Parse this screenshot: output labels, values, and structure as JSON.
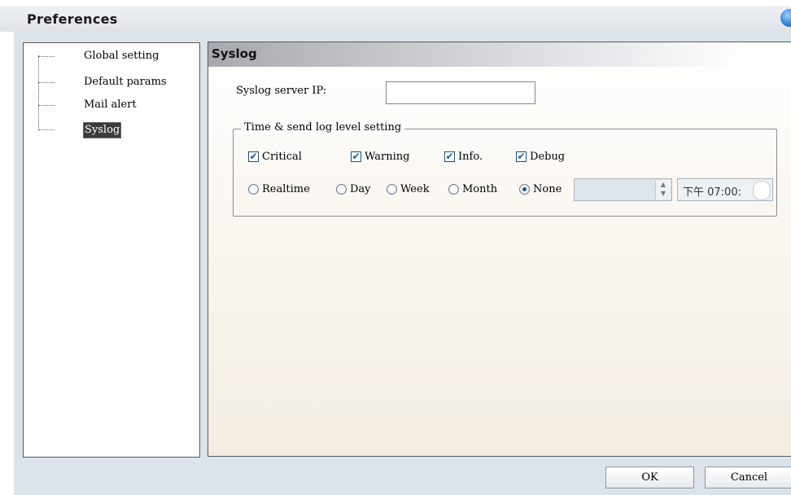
{
  "window": {
    "title": "Preferences"
  },
  "tree": {
    "items": [
      {
        "label": "Global setting"
      },
      {
        "label": "Default params"
      },
      {
        "label": "Mail alert"
      },
      {
        "label": "Syslog",
        "selected": true
      }
    ]
  },
  "section": {
    "title": "Syslog"
  },
  "syslog": {
    "server_ip_label": "Syslog server IP:",
    "server_ip_value": ""
  },
  "log_group": {
    "legend": "Time & send log level setting",
    "levels": [
      {
        "label": "Critical",
        "checked": true
      },
      {
        "label": "Warning",
        "checked": true
      },
      {
        "label": "Info.",
        "checked": true
      },
      {
        "label": "Debug",
        "checked": true
      }
    ],
    "schedule": [
      {
        "label": "Realtime",
        "selected": false
      },
      {
        "label": "Day",
        "selected": false
      },
      {
        "label": "Week",
        "selected": false
      },
      {
        "label": "Month",
        "selected": false
      },
      {
        "label": "None",
        "selected": true
      }
    ],
    "date_value": "",
    "time_value": "下午 07:00:"
  },
  "buttons": {
    "ok": "OK",
    "cancel": "Cancel"
  }
}
